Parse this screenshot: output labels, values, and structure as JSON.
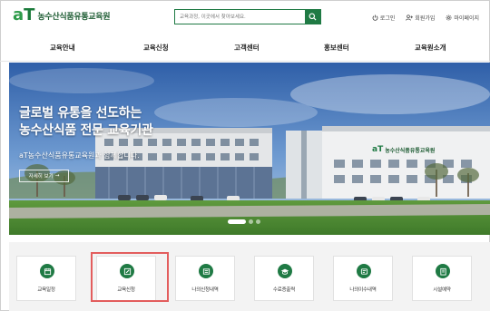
{
  "header": {
    "logo_mark_a": "a",
    "logo_mark_t": "T",
    "logo_text": "농수산식품유통교육원",
    "search_placeholder": "교육과정, 이곳에서 찾아보세요.",
    "utils": [
      {
        "label": "로그인",
        "icon": "power-icon"
      },
      {
        "label": "회원가입",
        "icon": "user-add-icon"
      },
      {
        "label": "마이페이지",
        "icon": "gear-icon"
      }
    ]
  },
  "nav": {
    "items": [
      "교육안내",
      "교육신청",
      "고객센터",
      "홍보센터",
      "교육원소개"
    ]
  },
  "hero": {
    "title_line1": "글로벌 유통을 선도하는",
    "title_line2": "농수산식품 전문 교육기관",
    "subtitle": "aT농수산식품유통교육원과 함께합니다.",
    "button_label": "자세히 보기",
    "building_sign_mark": "aT",
    "building_sign_text": "농수산식품유통교육원",
    "slide_count": 3,
    "active_slide": 1
  },
  "quick_menu": {
    "accent_color": "#1f7a44",
    "highlight_color": "#e35d5d",
    "highlighted_index": 1,
    "items": [
      {
        "label": "교육일정",
        "icon": "calendar-icon"
      },
      {
        "label": "교육신청",
        "icon": "edit-icon"
      },
      {
        "label": "나의신청내역",
        "icon": "list-icon"
      },
      {
        "label": "수료증출력",
        "icon": "graduation-cap-icon"
      },
      {
        "label": "나의이수내역",
        "icon": "certificate-icon"
      },
      {
        "label": "시설예약",
        "icon": "building-icon"
      }
    ]
  }
}
